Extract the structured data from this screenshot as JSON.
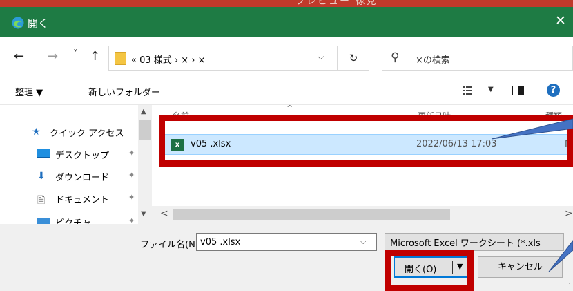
{
  "window": {
    "background_title": "プレビュー 橡見",
    "title": "開く",
    "accent": "#1e7b44"
  },
  "nav": {
    "back_icon": "←",
    "forward_icon": "→",
    "recent_icon": "˅",
    "up_icon": "↑",
    "address": "« 03 様式 › × › ×",
    "address_dropdown_icon": "⌵",
    "refresh_icon": "↻",
    "search_icon": "⚲",
    "search_placeholder": "×の検索"
  },
  "toolbar": {
    "organize": "整理 ▼",
    "new_folder": "新しいフォルダー",
    "view_dropdown": "▼",
    "help": "?"
  },
  "sidebar": {
    "scroll_up": "▲",
    "scroll_down": "▼",
    "items": [
      {
        "label": "クイック アクセス",
        "icon": "★",
        "pin": ""
      },
      {
        "label": "デスクトップ",
        "icon": "",
        "pin": "✦"
      },
      {
        "label": "ダウンロード",
        "icon": "⬇",
        "pin": "✦"
      },
      {
        "label": "ドキュメント",
        "icon": "🗎",
        "pin": "✦"
      },
      {
        "label": "ピクチャ",
        "icon": "",
        "pin": "✦"
      }
    ]
  },
  "file_list": {
    "columns": [
      "名前",
      "更新日時",
      "種類"
    ],
    "sort_indicator": "^",
    "files": [
      {
        "name": "v05 .xlsx",
        "modified": "2022/06/13 17:03",
        "type": "Mic",
        "icon_text": "x"
      }
    ],
    "scroll_left": "<",
    "scroll_right": ">"
  },
  "bottom": {
    "filename_label": "ファイル名(N):",
    "filename_value": "v05 .xlsx",
    "filename_dropdown": "⌵",
    "file_type": "Microsoft Excel ワークシート (*.xls",
    "open_label": "開く(O)",
    "open_split_icon": "▼",
    "cancel_label": "キャンセル",
    "resize_grip": "⋰"
  },
  "annotation": {
    "highlight_color": "#c00000",
    "callout_color": "#4472c4"
  }
}
